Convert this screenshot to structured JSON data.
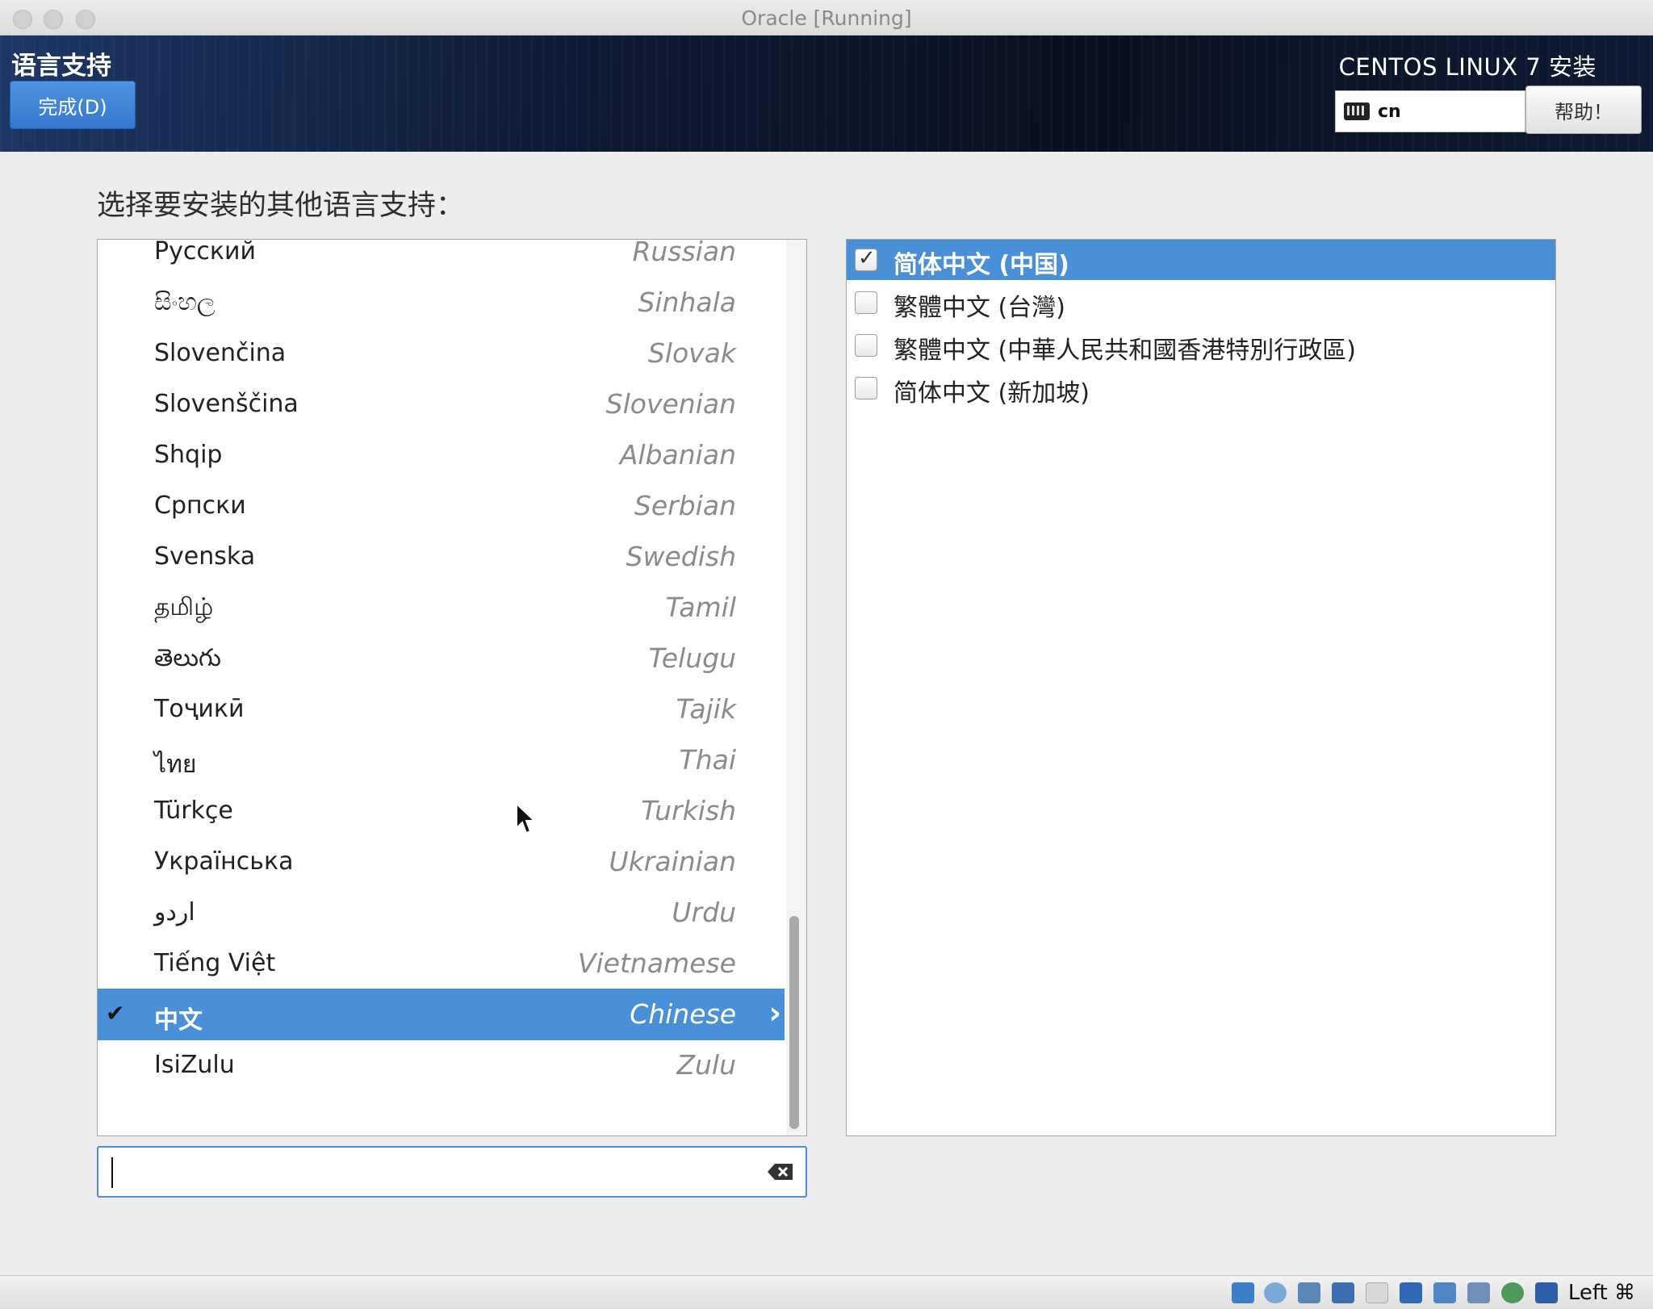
{
  "window": {
    "title": "Oracle [Running]"
  },
  "header": {
    "spoke_title": "语言支持",
    "done_button": "完成(D)",
    "product_title": "CENTOS LINUX 7 安装",
    "keyboard_layout": "cn",
    "help_button": "帮助！"
  },
  "prompt": "选择要安装的其他语言支持：",
  "languages": [
    {
      "native": "Русский",
      "english": "Russian"
    },
    {
      "native": "සිංහල",
      "english": "Sinhala"
    },
    {
      "native": "Slovenčina",
      "english": "Slovak"
    },
    {
      "native": "Slovenščina",
      "english": "Slovenian"
    },
    {
      "native": "Shqip",
      "english": "Albanian"
    },
    {
      "native": "Српски",
      "english": "Serbian"
    },
    {
      "native": "Svenska",
      "english": "Swedish"
    },
    {
      "native": "தமிழ்",
      "english": "Tamil"
    },
    {
      "native": "తెలుగు",
      "english": "Telugu"
    },
    {
      "native": "Тоҷикӣ",
      "english": "Tajik"
    },
    {
      "native": "ไทย",
      "english": "Thai"
    },
    {
      "native": "Türkçe",
      "english": "Turkish"
    },
    {
      "native": "Українська",
      "english": "Ukrainian"
    },
    {
      "native": "اردو",
      "english": "Urdu"
    },
    {
      "native": "Tiếng Việt",
      "english": "Vietnamese"
    },
    {
      "native": "中文",
      "english": "Chinese",
      "selected": true,
      "checked": true
    },
    {
      "native": "IsiZulu",
      "english": "Zulu"
    }
  ],
  "search": {
    "value": "",
    "placeholder": ""
  },
  "locales": [
    {
      "label": "简体中文 (中国)",
      "checked": true,
      "selected": true
    },
    {
      "label": "繁體中文 (台灣)",
      "checked": false
    },
    {
      "label": "繁體中文 (中華人民共和國香港特別行政區)",
      "checked": false
    },
    {
      "label": "简体中文 (新加坡)",
      "checked": false
    }
  ],
  "statusbar": {
    "host_key": "Left ⌘"
  },
  "colors": {
    "accent": "#4a90d9",
    "header_dark": "#0e1a33"
  }
}
